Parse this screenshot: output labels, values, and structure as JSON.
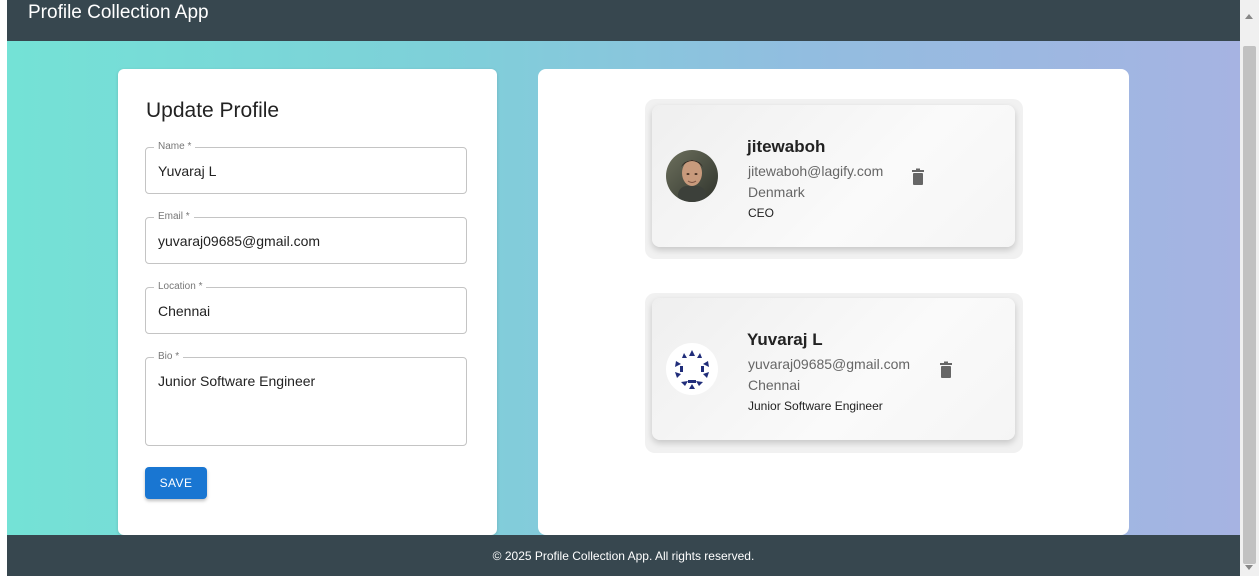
{
  "app": {
    "title": "Profile Collection App",
    "footer": "© 2025 Profile Collection App. All rights reserved."
  },
  "form": {
    "title": "Update Profile",
    "fields": [
      {
        "label": "Name *",
        "value": "Yuvaraj L"
      },
      {
        "label": "Email *",
        "value": "yuvaraj09685@gmail.com"
      },
      {
        "label": "Location *",
        "value": "Chennai"
      },
      {
        "label": "Bio *",
        "value": "Junior Software Engineer"
      }
    ],
    "save_label": "SAVE"
  },
  "profiles": [
    {
      "name": "jitewaboh",
      "email": "jitewaboh@lagify.com",
      "location": "Denmark",
      "bio": "CEO",
      "avatar": "photo"
    },
    {
      "name": "Yuvaraj L",
      "email": "yuvaraj09685@gmail.com",
      "location": "Chennai",
      "bio": "Junior Software Engineer",
      "avatar": "geometric-pattern"
    }
  ],
  "icons": {
    "delete": "trash-icon"
  },
  "colors": {
    "header": "#37474f",
    "primary": "#1976d2",
    "gradient_start": "#74e2d6",
    "gradient_end": "#a6b3e2"
  }
}
